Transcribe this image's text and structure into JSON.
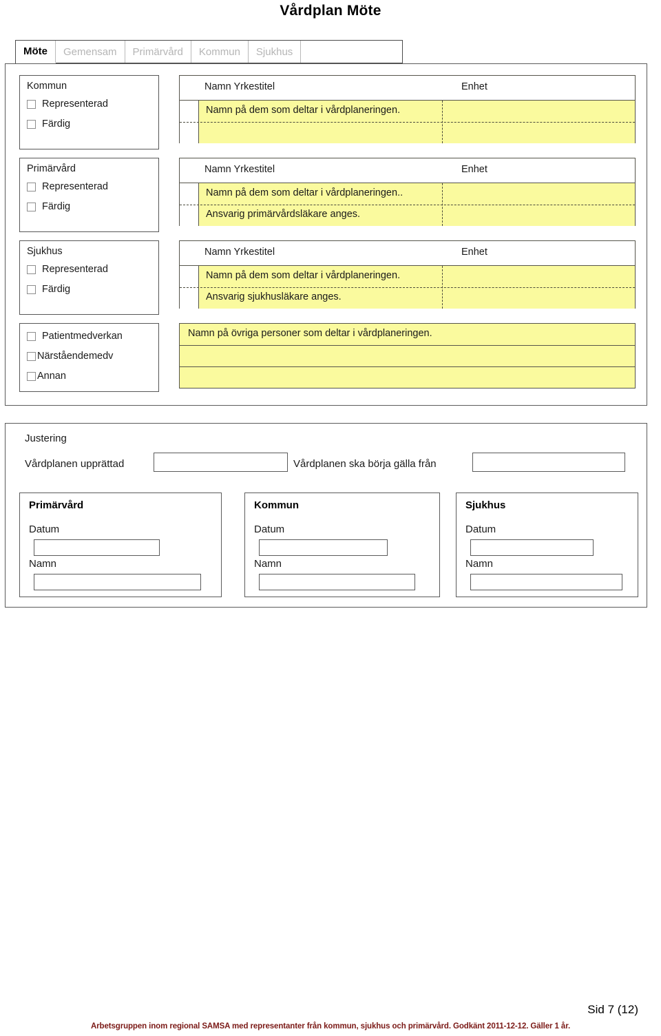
{
  "document": {
    "title": "Vårdplan Möte",
    "page_number": "Sid 7 (12)",
    "footer_note": "Arbetsgruppen inom regional SAMSA med representanter från kommun, sjukhus och primärvård. Godkänt 2011-12-12. Gäller 1 år.",
    "footer_color": "#7b1a17"
  },
  "tabs": [
    {
      "label": "Möte",
      "active": true
    },
    {
      "label": "Gemensam",
      "active": false
    },
    {
      "label": "Primärvård",
      "active": false
    },
    {
      "label": "Kommun",
      "active": false
    },
    {
      "label": "Sjukhus",
      "active": false
    }
  ],
  "participants": {
    "column_headers": {
      "name_title": "Namn Yrkestitel",
      "unit": "Enhet"
    },
    "field_color": "#fafa9e",
    "sections": [
      {
        "party": "Kommun",
        "checkboxes": [
          {
            "label": "Representerad",
            "checked": false
          },
          {
            "label": "Färdig",
            "checked": false
          }
        ],
        "hint_lines": [
          "Namn på dem som deltar i vårdplaneringen.",
          ""
        ]
      },
      {
        "party": "Primärvård",
        "checkboxes": [
          {
            "label": "Representerad",
            "checked": false
          },
          {
            "label": "Färdig",
            "checked": false
          }
        ],
        "hint_lines": [
          "Namn på dem som deltar i vårdplaneringen..",
          "Ansvarig primärvårdsläkare anges."
        ]
      },
      {
        "party": "Sjukhus",
        "checkboxes": [
          {
            "label": "Representerad",
            "checked": false
          },
          {
            "label": "Färdig",
            "checked": false
          }
        ],
        "hint_lines": [
          "Namn på dem som deltar i vårdplaneringen.",
          "Ansvarig sjukhusläkare anges."
        ]
      }
    ],
    "other": {
      "checkboxes": [
        {
          "label": "Patientmedverkan",
          "checked": false
        },
        {
          "label": "Närståendemedv",
          "checked": false
        },
        {
          "label": "Annan",
          "checked": false
        }
      ],
      "hint_line": "Namn på övriga personer som deltar i vårdplaneringen.",
      "empty_rows": 2
    }
  },
  "justering": {
    "title": "Justering",
    "created_label": "Vårdplanen upprättad",
    "created_value": "",
    "valid_from_label": "Vårdplanen ska börja gälla från",
    "valid_from_value": "",
    "signature_blocks": [
      {
        "title": "Primärvård",
        "date_label": "Datum",
        "date_value": "",
        "name_label": "Namn",
        "name_value": ""
      },
      {
        "title": "Kommun",
        "date_label": "Datum",
        "date_value": "",
        "name_label": "Namn",
        "name_value": ""
      },
      {
        "title": "Sjukhus",
        "date_label": "Datum",
        "date_value": "",
        "name_label": "Namn",
        "name_value": ""
      }
    ]
  }
}
